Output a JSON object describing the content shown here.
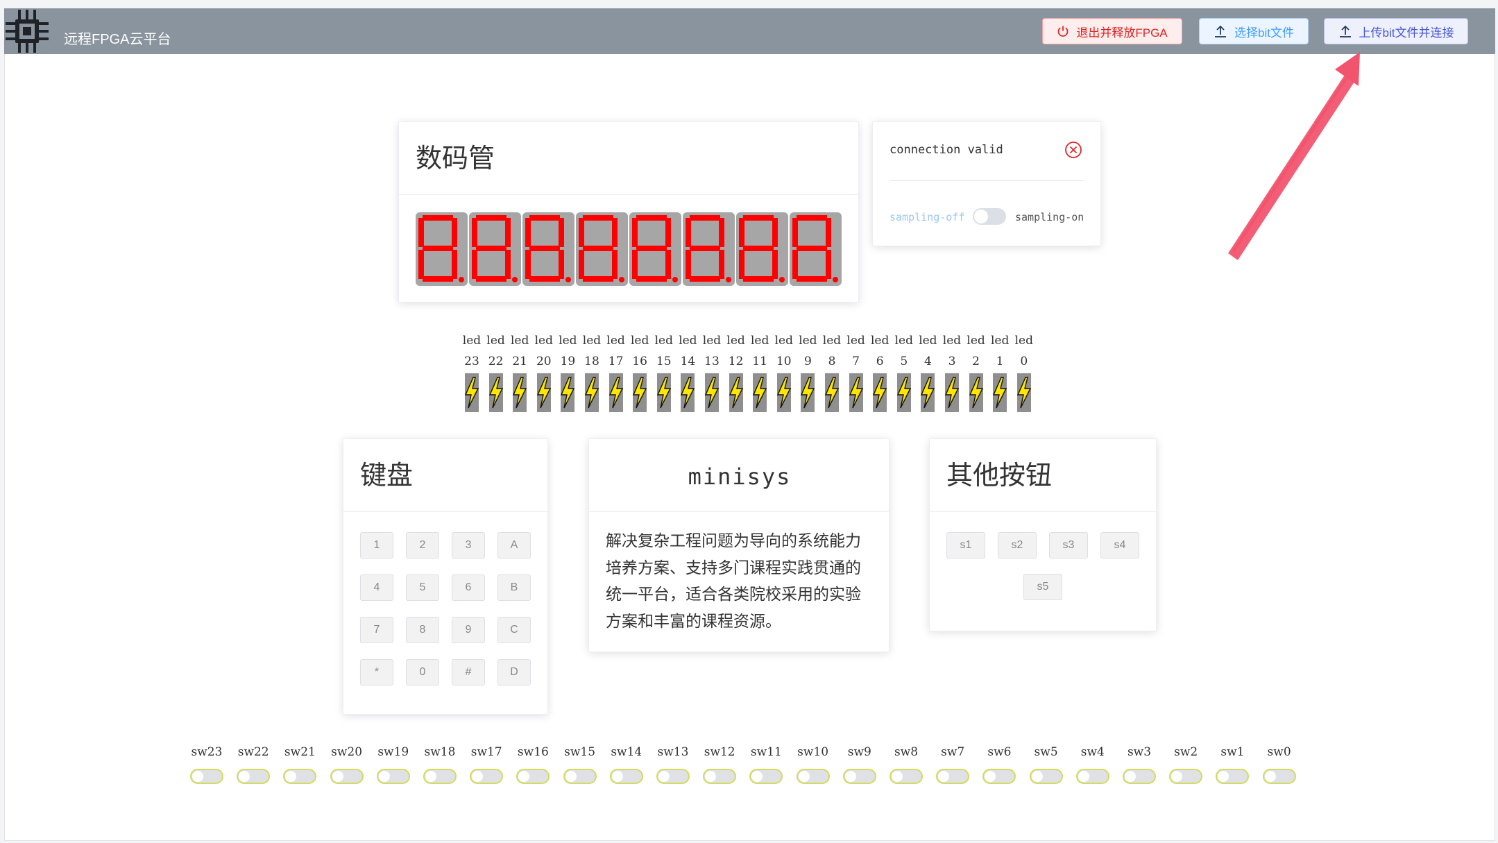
{
  "app": {
    "title": "远程FPGA云平台"
  },
  "toolbar": {
    "exit_label": "退出并释放FPGA",
    "select_label": "选择bit文件",
    "upload_label": "上传bit文件并连接"
  },
  "seg_display": {
    "title": "数码管",
    "digit_count": 8,
    "segment_color": "#ff0000",
    "background_color": "#a6a6a6"
  },
  "connection": {
    "status_text": "connection valid",
    "sampling_off": "sampling-off",
    "sampling_on": "sampling-on"
  },
  "leds": {
    "prefix": "led",
    "items": [
      "23",
      "22",
      "21",
      "20",
      "19",
      "18",
      "17",
      "16",
      "15",
      "14",
      "13",
      "12",
      "11",
      "10",
      "9",
      "8",
      "7",
      "6",
      "5",
      "4",
      "3",
      "2",
      "1",
      "0"
    ],
    "icon": "lightning-bolt-icon",
    "color": "#ffe600"
  },
  "keyboard": {
    "title": "键盘",
    "keys": [
      "1",
      "2",
      "3",
      "A",
      "4",
      "5",
      "6",
      "B",
      "7",
      "8",
      "9",
      "C",
      "*",
      "0",
      "#",
      "D"
    ]
  },
  "minisys": {
    "title": "minisys",
    "lines": [
      "解决复杂工程问题为导向的系统能力",
      "培养方案、支持多门课程实践贯通的",
      "统一平台，适合各类院校采用的实验",
      "方案和丰富的课程资源。"
    ]
  },
  "other_buttons": {
    "title": "其他按钮",
    "buttons": [
      "s1",
      "s2",
      "s3",
      "s4",
      "s5"
    ]
  },
  "switches": {
    "items": [
      "sw23",
      "sw22",
      "sw21",
      "sw20",
      "sw19",
      "sw18",
      "sw17",
      "sw16",
      "sw15",
      "sw14",
      "sw13",
      "sw12",
      "sw11",
      "sw10",
      "sw9",
      "sw8",
      "sw7",
      "sw6",
      "sw5",
      "sw4",
      "sw3",
      "sw2",
      "sw1",
      "sw0"
    ],
    "accent_color": "#d3dc5c"
  },
  "annotation": {
    "arrow_color": "#f2546e"
  }
}
